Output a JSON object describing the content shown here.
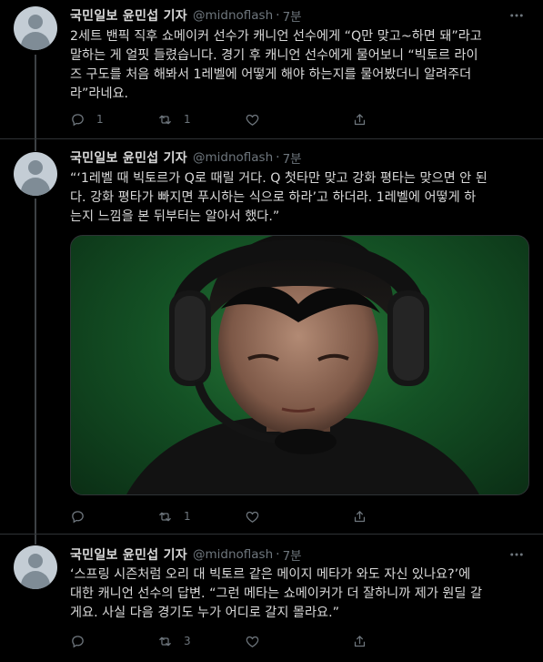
{
  "tweets": [
    {
      "author_name": "국민일보 윤민섭 기자",
      "handle": "@midnoflash",
      "separator": "·",
      "time": "7분",
      "text_lines": [
        "2세트 밴픽 직후 쇼메이커 선수가 캐니언 선수에게 “Q만 맞고~하면 돼”라고",
        "말하는 게 얼핏 들렸습니다. 경기 후 캐니언 선수에게 물어보니 “빅토르 라이",
        "즈 구도를 처음 해봐서 1레벨에 어떻게 해야 하는지를 물어봤더니 알려주더",
        "라”라네요."
      ],
      "reply_count": "1",
      "retweet_count": "1",
      "like_count": ""
    },
    {
      "author_name": "국민일보 윤민섭 기자",
      "handle": "@midnoflash",
      "separator": "·",
      "time": "7분",
      "text_lines": [
        "“‘1레벨 때 빅토르가 Q로 때릴 거다. Q 첫타만 맞고 강화 평타는 맞으면 안 된",
        "다. 강화 평타가 빠지면 푸시하는 식으로 하라’고 하더라. 1레벨에 어떻게 하",
        "는지 느낌을 본 뒤부터는 알아서 했다.”"
      ],
      "image_alt": "player wearing headset with microphone",
      "reply_count": "",
      "retweet_count": "1",
      "like_count": ""
    },
    {
      "author_name": "국민일보 윤민섭 기자",
      "handle": "@midnoflash",
      "separator": "·",
      "time": "7분",
      "text_lines": [
        "‘스프링 시즌처럼 오리 대 빅토르 같은 메이지 메타가 와도 자신 있나요?’에",
        "대한 캐니언 선수의 답변. “그런 메타는 쇼메이커가 더 잘하니까 제가 원딜 갈",
        "게요. 사실 다음 경기도 누가 어디로 갈지 몰라요.”"
      ],
      "reply_count": "",
      "retweet_count": "3",
      "like_count": ""
    }
  ]
}
